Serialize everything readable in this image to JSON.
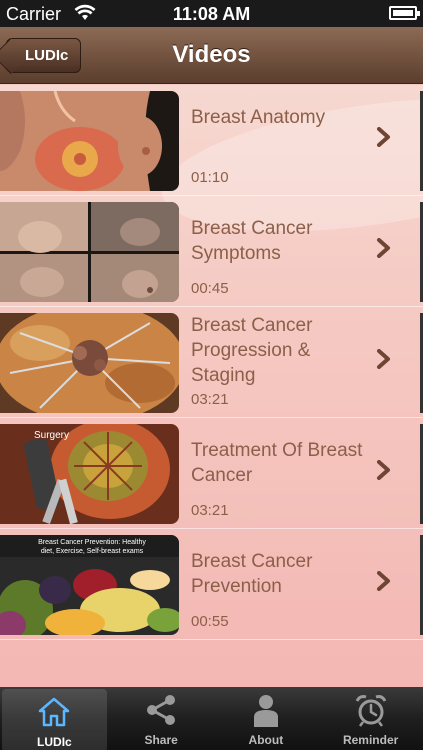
{
  "status_bar": {
    "carrier": "Carrier",
    "time": "11:08 AM"
  },
  "nav": {
    "back_label": "LUDIc",
    "title": "Videos"
  },
  "videos": [
    {
      "title": "Breast Anatomy",
      "duration": "01:10",
      "thumbnail": "anatomy"
    },
    {
      "title": "Breast Cancer Symptoms",
      "duration": "00:45",
      "thumbnail": "symptoms"
    },
    {
      "title": "Breast Cancer Progression & Staging",
      "duration": "03:21",
      "thumbnail": "staging"
    },
    {
      "title": "Treatment Of Breast Cancer",
      "duration": "03:21",
      "thumbnail": "treatment",
      "overlay": "Surgery"
    },
    {
      "title": "Breast Cancer Prevention",
      "duration": "00:55",
      "thumbnail": "prevention",
      "overlay": "Breast Cancer Prevention: Healthy diet, Exercise, Self-breast exams"
    }
  ],
  "tabs": [
    {
      "label": "LUDIc",
      "icon": "home-icon",
      "active": true
    },
    {
      "label": "Share",
      "icon": "share-icon",
      "active": false
    },
    {
      "label": "About",
      "icon": "person-icon",
      "active": false
    },
    {
      "label": "Reminder",
      "icon": "alarm-clock-icon",
      "active": false
    }
  ]
}
